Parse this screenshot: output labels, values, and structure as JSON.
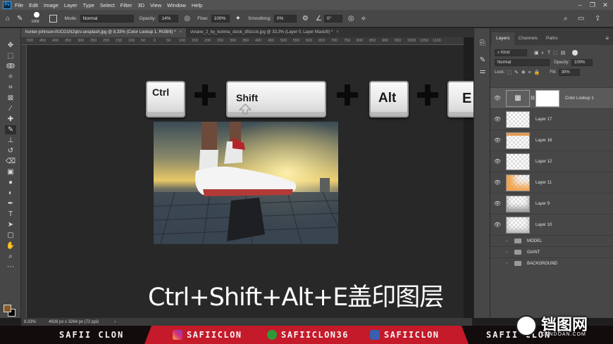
{
  "menubar": {
    "logo": "Ps",
    "items": [
      "File",
      "Edit",
      "Image",
      "Layer",
      "Type",
      "Select",
      "Filter",
      "3D",
      "View",
      "Window",
      "Help"
    ]
  },
  "options": {
    "brush_size": "1000",
    "mode_label": "Mode:",
    "mode_value": "Normal",
    "opacity_label": "Opacity:",
    "opacity_value": "14%",
    "flow_label": "Flow:",
    "flow_value": "100%",
    "smoothing_label": "Smoothing:",
    "smoothing_value": "0%",
    "angle_value": "0°"
  },
  "tabs": [
    {
      "label": "hunter-johnson-0UCG1N2qtrs-unsplash.jpg @ 8,33% (Color Lookup 1, RGB/8) *"
    },
    {
      "label": "viviane_2_by_konma_stock_d5izcck.jpg @ 33,3% (Layer 0, Layer Mask/8) *"
    }
  ],
  "ruler": [
    "500",
    "450",
    "400",
    "350",
    "300",
    "250",
    "200",
    "150",
    "100",
    "50",
    "0",
    "50",
    "100",
    "150",
    "200",
    "250",
    "300",
    "350",
    "400",
    "450",
    "500",
    "550",
    "600",
    "650",
    "700",
    "750",
    "800",
    "850",
    "900",
    "950",
    "1000",
    "1050",
    "1100"
  ],
  "status": {
    "zoom": "8,33%",
    "doc_size": "4928 px x 3264 px (72 ppi)"
  },
  "panel": {
    "tabs": [
      "Layers",
      "Channels",
      "Paths"
    ],
    "kind_label": "Kind",
    "blend_mode": "Normal",
    "opacity_label": "Opacity:",
    "opacity_value": "100%",
    "lock_label": "Lock:",
    "fill_label": "Fill:",
    "fill_value": "30%",
    "layers": [
      {
        "name": "Color Lookup 1",
        "selected": true
      },
      {
        "name": "Layer 17"
      },
      {
        "name": "Layer 16"
      },
      {
        "name": "Layer 12"
      },
      {
        "name": "Layer 11"
      },
      {
        "name": "Layer 9"
      },
      {
        "name": "Layer 10"
      }
    ],
    "groups": [
      "MODEL",
      "GIANT",
      "BACKGROUND"
    ]
  },
  "shortcut": {
    "keys": [
      "Ctrl",
      "Shift",
      "Alt",
      "E"
    ],
    "caption": "Ctrl+Shift+Alt+E盖印图层"
  },
  "brand": {
    "left_name": "SAFII CLON",
    "instagram": "SAFIICLON",
    "xbox": "SAFIICLON36",
    "facebook": "SAFIICLON",
    "right_name": "SAFII CLON"
  },
  "watermark": {
    "title": "铛图网",
    "sub": "CTNDOAN.COM"
  },
  "colors": {
    "accent_blue": "#31a8ff",
    "brand_red": "#c41a2a",
    "foreground_color": "#8a5a2b",
    "background_color": "#000000"
  }
}
